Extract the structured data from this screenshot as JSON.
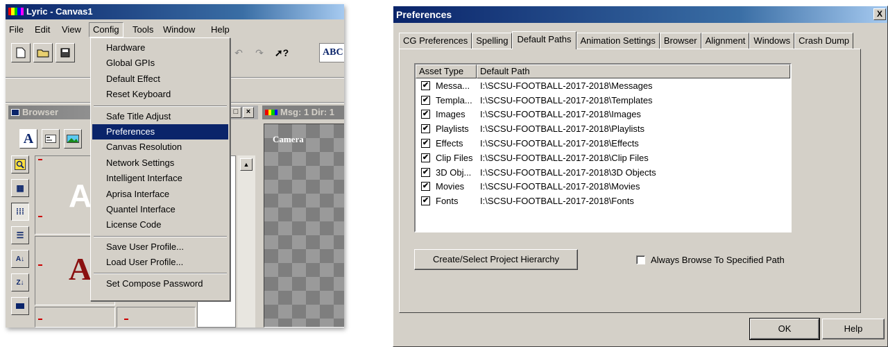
{
  "lyric": {
    "title": "Lyric - Canvas1",
    "menu": [
      "File",
      "Edit",
      "View",
      "Config",
      "Tools",
      "Window",
      "Help"
    ],
    "abc_label": "ABC",
    "browser_title": "Browser",
    "msg_title": "Msg: 1  Dir: 1",
    "canvas_label": "Camera",
    "thumb_text_1": "AA",
    "thumb_text_2": "Aa",
    "config_menu": [
      "Hardware",
      "Global GPIs",
      "Default Effect",
      "Reset Keyboard",
      "Safe Title Adjust",
      "Preferences",
      "Canvas Resolution",
      "Network Settings",
      "Intelligent Interface",
      "Aprisa Interface",
      "Quantel Interface",
      "License Code",
      "Save User Profile...",
      "Load User Profile...",
      "Set Compose Password"
    ],
    "config_highlighted": "Preferences",
    "icons": {
      "new": "new-document-icon",
      "open": "open-folder-icon",
      "save": "save-disk-icon",
      "help": "context-help-icon",
      "undo": "undo-icon",
      "redo": "redo-icon"
    }
  },
  "prefs": {
    "title": "Preferences",
    "tabs": [
      "CG Preferences",
      "Spelling",
      "Default Paths",
      "Animation Settings",
      "Browser",
      "Alignment",
      "Windows",
      "Crash Dump"
    ],
    "active_tab": "Default Paths",
    "columns": [
      "Asset Type",
      "Default Path"
    ],
    "rows": [
      {
        "type": "Messa...",
        "path": "I:\\SCSU-FOOTBALL-2017-2018\\Messages",
        "checked": true
      },
      {
        "type": "Templa...",
        "path": "I:\\SCSU-FOOTBALL-2017-2018\\Templates",
        "checked": true
      },
      {
        "type": "Images",
        "path": "I:\\SCSU-FOOTBALL-2017-2018\\Images",
        "checked": true
      },
      {
        "type": "Playlists",
        "path": "I:\\SCSU-FOOTBALL-2017-2018\\Playlists",
        "checked": true
      },
      {
        "type": "Effects",
        "path": "I:\\SCSU-FOOTBALL-2017-2018\\Effects",
        "checked": true
      },
      {
        "type": "Clip Files",
        "path": "I:\\SCSU-FOOTBALL-2017-2018\\Clip Files",
        "checked": true
      },
      {
        "type": "3D Obj...",
        "path": "I:\\SCSU-FOOTBALL-2017-2018\\3D Objects",
        "checked": true
      },
      {
        "type": "Movies",
        "path": "I:\\SCSU-FOOTBALL-2017-2018\\Movies",
        "checked": true
      },
      {
        "type": "Fonts",
        "path": "I:\\SCSU-FOOTBALL-2017-2018\\Fonts",
        "checked": true
      }
    ],
    "create_button": "Create/Select Project Hierarchy",
    "always_browse_label": "Always Browse To Specified Path",
    "always_browse_checked": false,
    "ok_button": "OK",
    "help_button": "Help",
    "close_glyph": "X"
  }
}
